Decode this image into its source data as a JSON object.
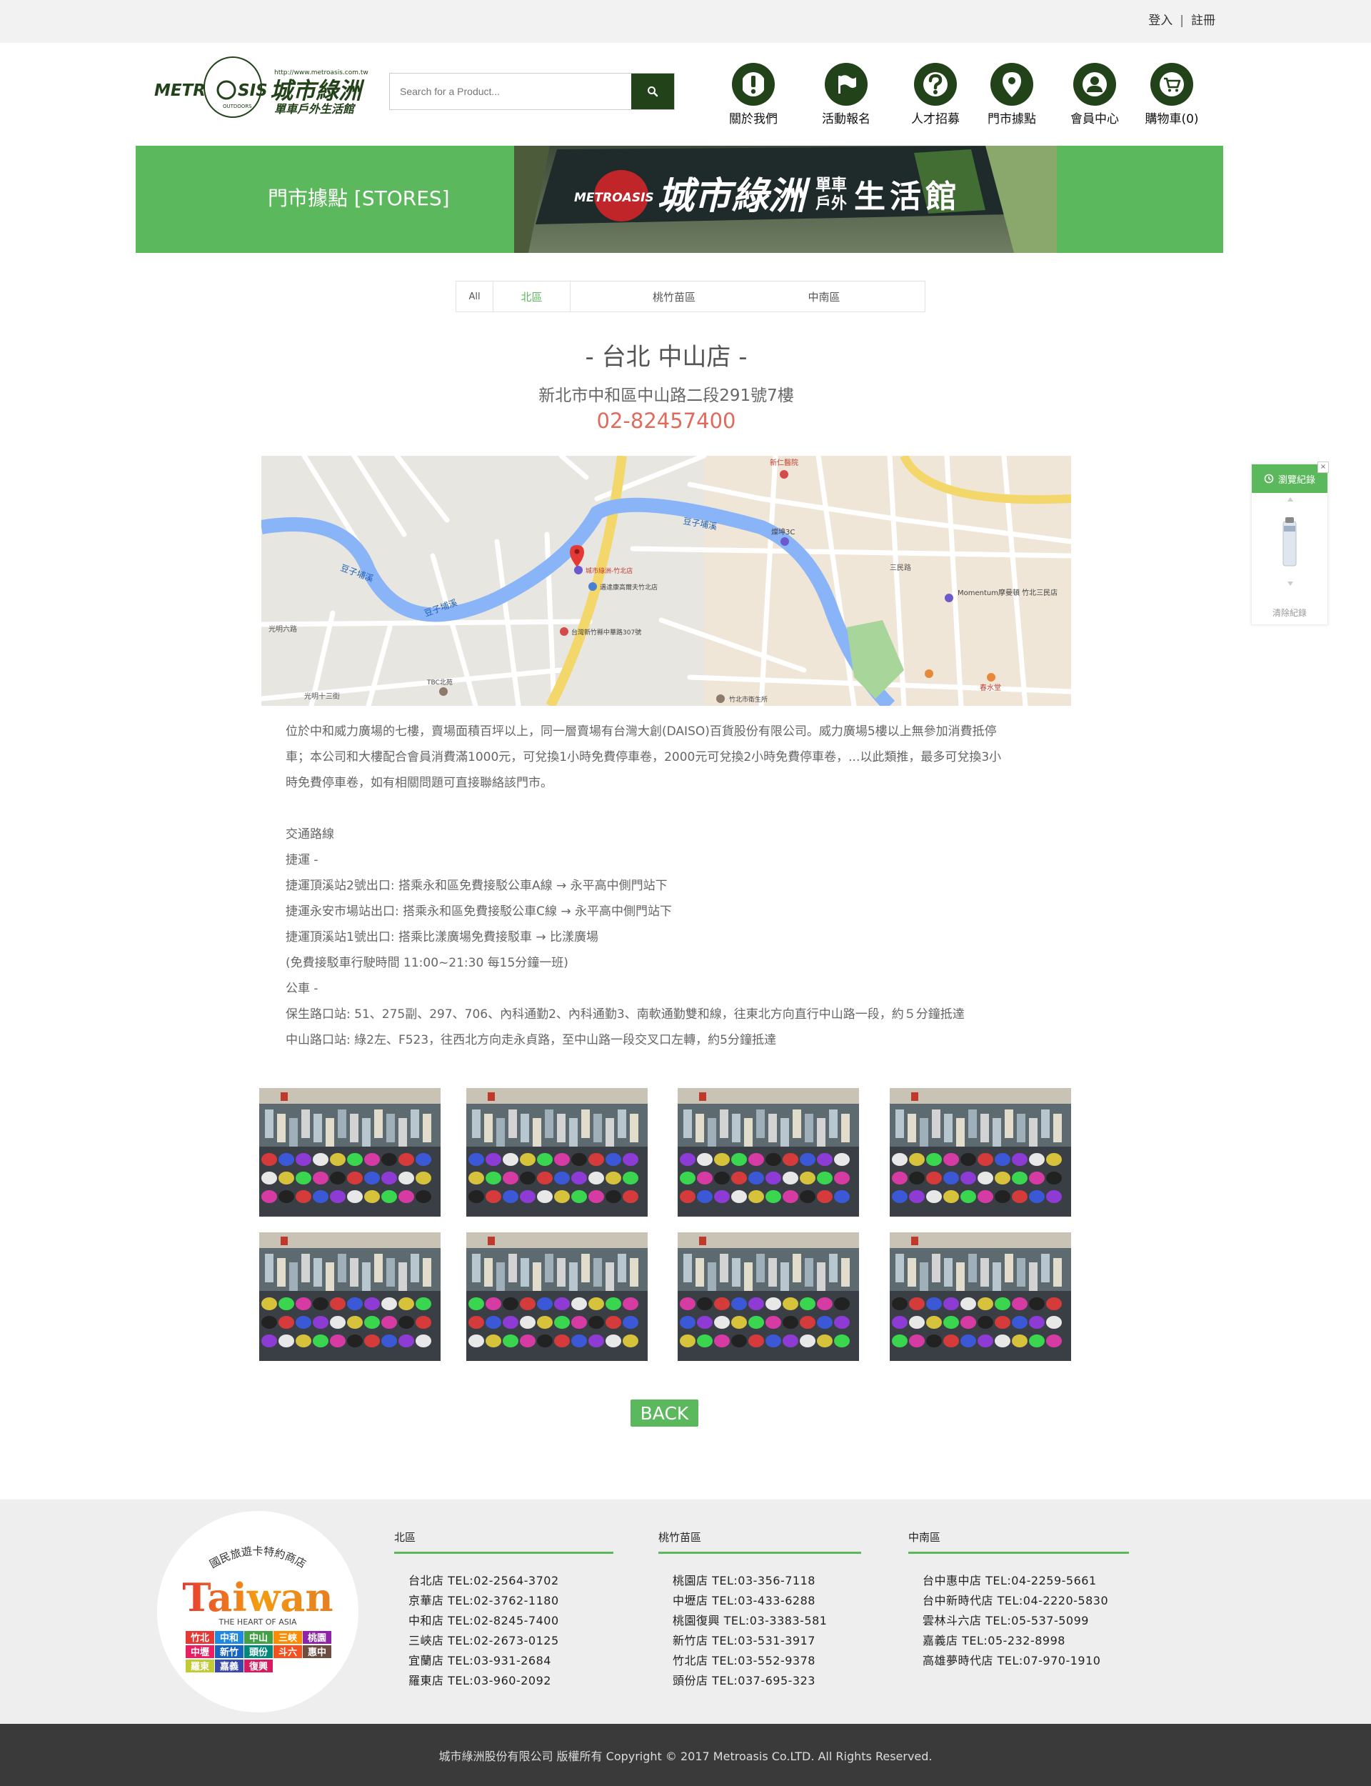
{
  "topbar": {
    "login": "登入",
    "separator": "|",
    "register": "註冊"
  },
  "logo": {
    "brand_en_left": "METR",
    "brand_en_right": "SIS",
    "brand_sub": "OUTDOORS",
    "url": "http://www.metroasis.com.tw/",
    "brand_zh": "城市綠洲",
    "tagline": "單車戶外生活館"
  },
  "search": {
    "placeholder": "Search for a Product..."
  },
  "nav": {
    "items": [
      {
        "label": "關於我們",
        "icon": "exclamation-icon"
      },
      {
        "label": "活動報名",
        "icon": "flag-icon"
      },
      {
        "label": "人才招募",
        "icon": "question-icon"
      },
      {
        "label": "門市據點",
        "icon": "map-pin-icon"
      },
      {
        "label": "會員中心",
        "icon": "user-icon"
      },
      {
        "label": "購物車(0)",
        "icon": "cart-icon"
      }
    ]
  },
  "banner": {
    "title": "門市據點 [STORES]",
    "sign_brand_en": "METROASIS",
    "sign_brand_zh": "城市綠洲",
    "sign_small_top": "單車",
    "sign_small_bottom": "戶外",
    "sign_tail": "生活館"
  },
  "tabs": [
    {
      "label": "All"
    },
    {
      "label": "北區",
      "active": true
    },
    {
      "label": "桃竹苗區"
    },
    {
      "label": "中南區"
    }
  ],
  "store": {
    "name": "- 台北 中山店 -",
    "address": "新北市中和區中山路二段291號7樓",
    "phone": "02-82457400"
  },
  "map": {
    "labels": {
      "river1": "豆子埔溪",
      "river2": "豆子埔溪",
      "river3": "豆子埔溪",
      "poi_store": "城市綠洲-竹北店",
      "poi_hotel": "遇達康高爾夫竹北店",
      "poi_bank": "台灣新竹縣中華路307號",
      "poi_3c": "燦坤3C",
      "poi_momentum": "Momentum摩曼頓 竹北三民店",
      "poi_hospital": "新仁醫院",
      "poi_tbc": "TBC北苑",
      "poi_office": "竹北市衛生所",
      "poi_spring": "春水堂",
      "road_guangming6": "光明六路",
      "road_guangming13": "光明十三街",
      "road_sanmin": "三民路"
    }
  },
  "description": {
    "intro": [
      "位於中和威力廣場的七樓，賣場面積百坪以上，同一層賣場有台灣大創(DAISO)百貨股份有限公司。威力廣場5樓以上無參加消費抵停",
      "車；本公司和大樓配合會員消費滿1000元，可兌換1小時免費停車卷，2000元可兌換2小時免費停車卷，...以此類推，最多可兌換3小",
      "時免費停車卷，如有相關問題可直接聯絡該門市。"
    ],
    "transport_title": "交通路線",
    "mrt_title": "捷運 -",
    "mrt_lines": [
      "捷運頂溪站2號出口: 搭乘永和區免費接駁公車A線 → 永平高中側門站下",
      "捷運永安市場站出口: 搭乘永和區免費接駁公車C線 → 永平高中側門站下",
      "捷運頂溪站1號出口: 搭乘比漾廣場免費接駁車 → 比漾廣場",
      "(免費接駁車行駛時間 11:00~21:30 每15分鐘一班)"
    ],
    "bus_title": "公車 -",
    "bus_lines": [
      "保生路口站: 51、275副、297、706、內科通勤2、內科通勤3、南軟通勤雙和線，往東北方向直行中山路一段，約５分鐘抵達",
      "中山路口站: 綠2左、F523，往西北方向走永貞路，至中山路一段交叉口左轉，約5分鐘抵達"
    ]
  },
  "gallery_count": 8,
  "back_label": "BACK",
  "side_widget": {
    "title": "瀏覽紀錄",
    "clear": "清除紀錄",
    "close": "×"
  },
  "footer": {
    "badge": {
      "arc_text": "國民旅遊卡特約商店",
      "word": "Taiwan",
      "sub": "THE HEART OF ASIA",
      "tags": [
        "竹北",
        "中和",
        "中山",
        "三峽",
        "桃園",
        "中壢",
        "新竹",
        "頭份",
        "斗六",
        "惠中",
        "羅東",
        "嘉義",
        "復興"
      ]
    },
    "columns": [
      {
        "title": "北區",
        "stores": [
          "台北店  TEL:02-2564-3702",
          "京華店  TEL:02-3762-1180",
          "中和店  TEL:02-8245-7400",
          "三峽店  TEL:02-2673-0125",
          "宜蘭店  TEL:03-931-2684",
          "羅東店  TEL:03-960-2092"
        ]
      },
      {
        "title": "桃竹苗區",
        "stores": [
          "桃園店  TEL:03-356-7118",
          "中壢店  TEL:03-433-6288",
          "桃園復興  TEL:03-3383-581",
          "新竹店  TEL:03-531-3917",
          "竹北店  TEL:03-552-9378",
          "頭份店  TEL:037-695-323"
        ]
      },
      {
        "title": "中南區",
        "stores": [
          "台中惠中店  TEL:04-2259-5661",
          "台中新時代店 TEL:04-2220-5830",
          "雲林斗六店 TEL:05-537-5099",
          "嘉義店 TEL:05-232-8998",
          "高雄夢時代店 TEL:07-970-1910"
        ]
      }
    ]
  },
  "copyright": "城市綠洲股份有限公司 版權所有 Copyright © 2017 Metroasis Co.LTD. All Rights Reserved.",
  "colors": {
    "brand_dark": "#224219",
    "accent_green": "#5cb85c",
    "phone_red": "#e06a5c",
    "footer_bg": "#eeeeee",
    "copyright_bg": "#3a3a3a"
  }
}
